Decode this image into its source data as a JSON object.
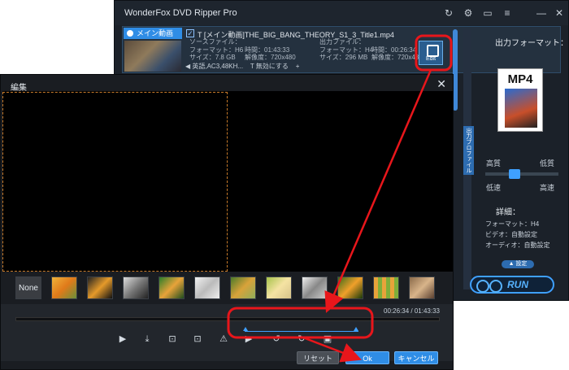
{
  "ripper": {
    "title": "WonderFox DVD Ripper Pro",
    "main_badge": "メイン動画",
    "checkbox": "✓",
    "file_name": "T [メイン動画]THE_BIG_BANG_THEORY_S1_3_Title1.mp4",
    "source": {
      "label": "ソースファイル：",
      "format": "フォーマット：H6",
      "size": "サイズ：7.8 GB",
      "time": "時間：01:43:33",
      "resolution": "解像度：720x480"
    },
    "output": {
      "label": "出力ファイル：",
      "format": "フォーマット：H4",
      "size": "サイズ：296 MB",
      "time": "時間：00:26:34",
      "resolution": "解像度：720x480"
    },
    "edit_label": "Edit",
    "audio_track": "英語,AC3,48KH...",
    "subtitle": "T 無効にする",
    "side_tab": "出力プロファイル",
    "output_format_title": "出力フォーマット：",
    "format_name": "MP4",
    "quality": {
      "high": "高質",
      "low": "低質",
      "slow": "低速",
      "fast": "高速",
      "level": 0.42
    },
    "detail": {
      "title": "詳細：",
      "format": "フォーマット：H4",
      "video": "ビデオ：自動設定",
      "audio": "オーディオ：自動設定"
    },
    "settings_label": "▲ 設定",
    "run_label": "RUN"
  },
  "edit": {
    "title": "編集",
    "close": "✕",
    "filters": [
      "None",
      "flower-warm",
      "flower-dark",
      "flower-gray",
      "flower-green",
      "flower-emboss",
      "flower-blur",
      "flower-bright",
      "flower-sketch",
      "flower-vivid",
      "grid-mosaic",
      "flower-sepia"
    ],
    "time_display": "00:26:34 / 01:43:33",
    "trim_start": 0.57,
    "trim_end": 0.84,
    "buttons": {
      "reset": "リセット",
      "ok": "Ok",
      "cancel": "キャンセル"
    }
  },
  "colors": {
    "accent": "#2f8de6",
    "annotation": "#e8161b",
    "crop_border": "#c67a2a"
  }
}
